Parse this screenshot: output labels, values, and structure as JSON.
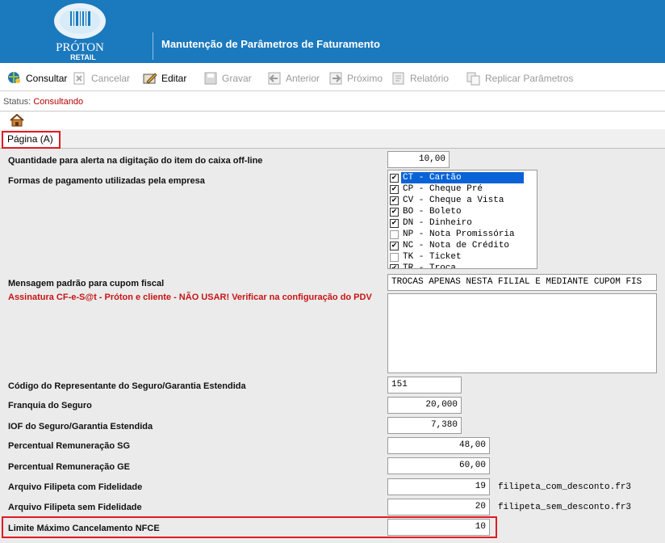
{
  "header": {
    "brand_name": "PRÓTON",
    "brand_sub": "RETAIL",
    "title": "Manutenção de Parâmetros de Faturamento"
  },
  "toolbar": {
    "consultar": "Consultar",
    "cancelar": "Cancelar",
    "editar": "Editar",
    "gravar": "Gravar",
    "anterior": "Anterior",
    "proximo": "Próximo",
    "relatorio": "Relatório",
    "replicar": "Replicar Parâmetros"
  },
  "status": {
    "label": "Status:",
    "value": "Consultando"
  },
  "tab": {
    "label": "Página (A)"
  },
  "fields": {
    "qtd_alerta": {
      "label": "Quantidade para alerta na digitação do item do caixa off-line",
      "value": "10,00"
    },
    "formas_pagamento": {
      "label": "Formas de pagamento utilizadas pela empresa",
      "items": [
        {
          "text": "CT - Cartão",
          "checked": true,
          "selected": true
        },
        {
          "text": "CP - Cheque Pré",
          "checked": true
        },
        {
          "text": "CV - Cheque a Vista",
          "checked": true
        },
        {
          "text": "BO - Boleto",
          "checked": true
        },
        {
          "text": "DN - Dinheiro",
          "checked": true
        },
        {
          "text": "NP - Nota Promissória",
          "checked": false
        },
        {
          "text": "NC - Nota de Crédito",
          "checked": true
        },
        {
          "text": "TK - Ticket",
          "checked": false
        },
        {
          "text": "TR - Troca",
          "checked": true
        }
      ]
    },
    "mensagem_cupom": {
      "label": "Mensagem padrão para cupom fiscal",
      "value": "TROCAS APENAS NESTA FILIAL E MEDIANTE CUPOM FIS"
    },
    "assinatura_sat": {
      "label": "Assinatura CF-e-S@t - Próton e cliente - NÃO USAR! Verificar na configuração do PDV",
      "value": ""
    },
    "cod_representante": {
      "label": "Código do Representante do Seguro/Garantia Estendida",
      "value": "151"
    },
    "franquia_seguro": {
      "label": "Franquia do Seguro",
      "value": "20,000"
    },
    "iof_seguro": {
      "label": "IOF do Seguro/Garantia Estendida",
      "value": "7,380"
    },
    "perc_sg": {
      "label": "Percentual Remuneração SG",
      "value": "48,00"
    },
    "perc_ge": {
      "label": "Percentual Remuneração GE",
      "value": "60,00"
    },
    "filipeta_com": {
      "label": "Arquivo Filipeta com Fidelidade",
      "value": "19",
      "file": "filipeta_com_desconto.fr3"
    },
    "filipeta_sem": {
      "label": "Arquivo Filipeta sem Fidelidade",
      "value": "20",
      "file": "filipeta_sem_desconto.fr3"
    },
    "limite_nfce": {
      "label": "Limite Máximo Cancelamento NFCE",
      "value": "10"
    }
  },
  "colors": {
    "header_blue": "#1b79be",
    "highlight_red": "#e01b24",
    "status_red": "#b80000",
    "selection_blue": "#0a63d6"
  },
  "icons": [
    "proton-logo",
    "globe-search-icon",
    "cancel-doc-icon",
    "edit-pencil-icon",
    "save-disk-icon",
    "arrow-left-icon",
    "arrow-right-icon",
    "report-icon",
    "replicate-icon",
    "house-icon"
  ]
}
